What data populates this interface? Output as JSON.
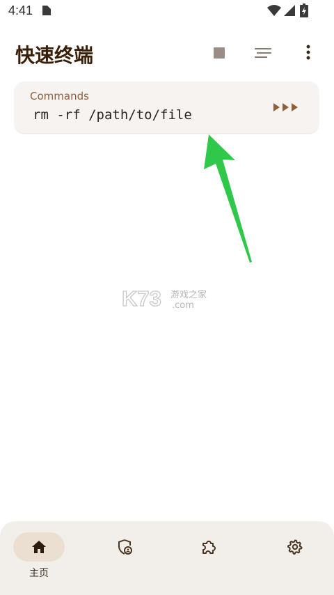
{
  "status_bar": {
    "time": "4:41"
  },
  "app_bar": {
    "title": "快速终端"
  },
  "command_card": {
    "label": "Commands",
    "command": "rm -rf /path/to/file"
  },
  "watermark": {
    "text": "K73 游戏之家 .com"
  },
  "bottom_nav": {
    "items": [
      {
        "label": "主页",
        "icon": "home-icon",
        "selected": true
      },
      {
        "label": "",
        "icon": "shield-user-icon",
        "selected": false
      },
      {
        "label": "",
        "icon": "puzzle-icon",
        "selected": false
      },
      {
        "label": "",
        "icon": "gear-icon",
        "selected": false
      }
    ]
  },
  "colors": {
    "title": "#3a1f08",
    "accent": "#8f5f3c",
    "card_bg": "#f7f3f0",
    "nav_bg": "#f2efeb",
    "nav_indicator": "#ebdfd1",
    "annotation_arrow": "#2fc84a"
  }
}
